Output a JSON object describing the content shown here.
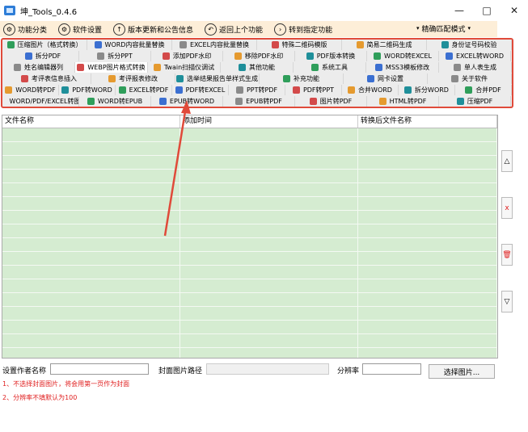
{
  "window": {
    "title": "坤_Tools_0.4.6",
    "min": "—",
    "max": "□",
    "close": "✕"
  },
  "toolbar": {
    "items": [
      {
        "label": "功能分类",
        "icon": "⚙"
      },
      {
        "label": "软件设置",
        "icon": "⚙"
      },
      {
        "label": "版本更新和公告信息",
        "icon": "↑"
      },
      {
        "label": "返回上个功能",
        "icon": "↶"
      },
      {
        "label": "转到指定功能",
        "icon": "›"
      }
    ],
    "match_mode": "精确匹配模式"
  },
  "functions": {
    "rows": [
      [
        "压缩图片（格式转换）",
        "WORD内容批量替换",
        "EXCEL内容批量替换",
        "特殊二维码模版",
        "简易二维码生成",
        "身份证号码校验"
      ],
      [
        "拆分PDF",
        "拆分PPT",
        "添加PDF水印",
        "移除PDF水印",
        "PDF版本转换",
        "WORD转EXCEL",
        "EXCEL转WORD"
      ],
      [
        "姓名编辑器列",
        "WEBP图片格式转换",
        "Twain扫描仪调试",
        "其他功能",
        "系统工具",
        "MSS3模板修改",
        "单人表生成"
      ],
      [
        "考评表信息插入",
        "考评报表修改",
        "选举结果报告单样式生成",
        "补充功能",
        "网卡设置",
        "关于软件"
      ],
      [
        "WORD转PDF",
        "PDF转WORD",
        "EXCEL转PDF",
        "PDF转EXCEL",
        "PPT转PDF",
        "PDF转PPT",
        "合并WORD",
        "拆分WORD",
        "合并PDF"
      ],
      [
        "WORD/PDF/EXCEL转图片",
        "WORD转EPUB",
        "EPUB转WORD",
        "EPUB转PDF",
        "图片转PDF",
        "HTML转PDF",
        "压缩PDF"
      ]
    ],
    "selected": "WEBP图片格式转换",
    "icon_colors": [
      "#2f9e5a",
      "#3b6fd1",
      "#8a8a8a",
      "#d34a4a",
      "#e59a2f",
      "#1f8f9a"
    ]
  },
  "table": {
    "headers": [
      "文件名称",
      "添加时间",
      "转换后文件名称"
    ],
    "row_count": 18
  },
  "side_buttons": [
    "△",
    "x",
    "🗑",
    "▽"
  ],
  "form": {
    "author_label": "设置作者名称",
    "author_value": "",
    "cover_label": "封面图片路径",
    "cover_value": "",
    "dpi_label": "分辨率",
    "dpi_value": "",
    "choose_button": "选择图片..."
  },
  "notes": [
    "1、不选择封面图片，将会用第一页作为封面",
    "2、分辨率不填默认为100"
  ],
  "colors": {
    "highlight": "#e04a3a",
    "toolbar_bg": "#fdeed8",
    "table_bg": "#d5ecd1"
  }
}
